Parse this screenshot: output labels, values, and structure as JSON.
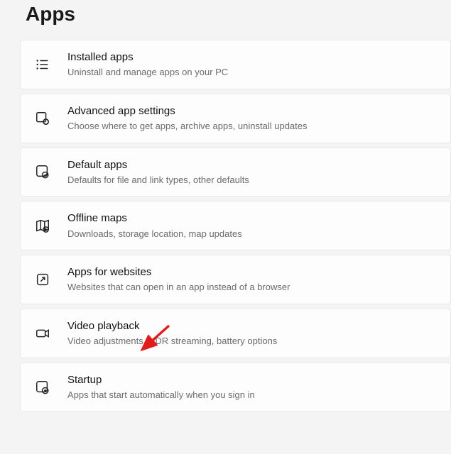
{
  "page_title": "Apps",
  "items": [
    {
      "title": "Installed apps",
      "subtitle": "Uninstall and manage apps on your PC",
      "icon": "list-icon"
    },
    {
      "title": "Advanced app settings",
      "subtitle": "Choose where to get apps, archive apps, uninstall updates",
      "icon": "app-gear-icon"
    },
    {
      "title": "Default apps",
      "subtitle": "Defaults for file and link types, other defaults",
      "icon": "default-app-icon"
    },
    {
      "title": "Offline maps",
      "subtitle": "Downloads, storage location, map updates",
      "icon": "map-icon"
    },
    {
      "title": "Apps for websites",
      "subtitle": "Websites that can open in an app instead of a browser",
      "icon": "open-external-icon"
    },
    {
      "title": "Video playback",
      "subtitle": "Video adjustments, HDR streaming, battery options",
      "icon": "video-icon"
    },
    {
      "title": "Startup",
      "subtitle": "Apps that start automatically when you sign in",
      "icon": "startup-icon"
    }
  ],
  "annotation": {
    "points_to_item_index": 5,
    "color": "#e21b1b"
  }
}
